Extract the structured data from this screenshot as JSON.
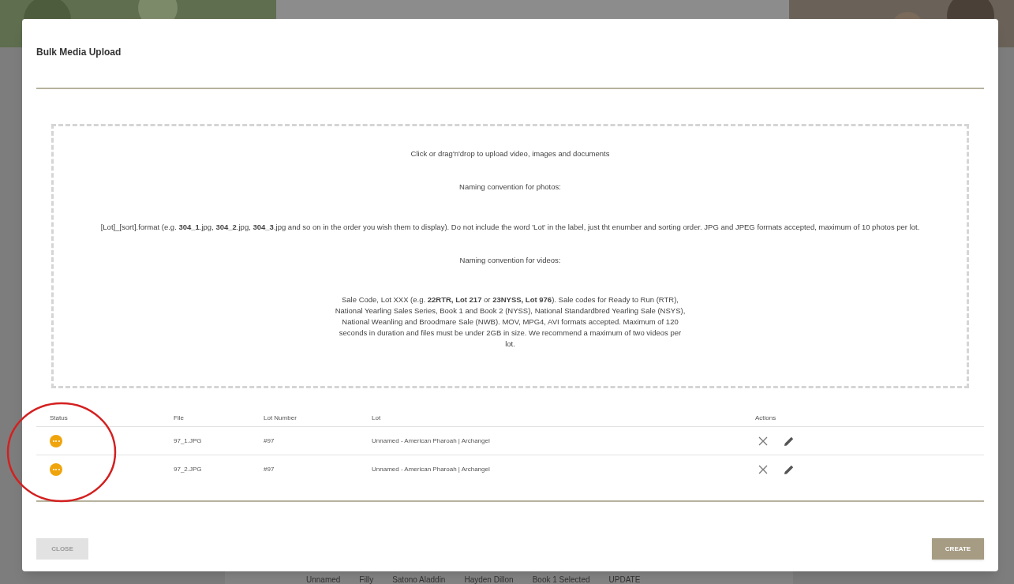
{
  "background": {
    "cells": [
      "Unnamed",
      "Filly",
      "Satono Aladdin",
      "Hayden Dillon",
      "Book 1 Selected",
      "UPDATE"
    ]
  },
  "dialog": {
    "title": "Bulk Media Upload",
    "dropzone": {
      "lines": [
        "Click or drag'n'drop to upload video, images and documents",
        "Naming convention for photos:",
        "[Lot]_[sort].format (e.g. **304_1**.jpg, **304_2**.jpg, **304_3**.jpg and so on in the order you wish them to display). Do not include the word 'Lot' in the label, just tht enumber and sorting order. JPG and JPEG formats accepted, maximum of 10 photos per lot.",
        "Naming convention for videos:",
        "Sale Code, Lot XXX (e.g. **22RTR, Lot 217** or **23NYSS, Lot 976**). Sale codes for Ready to Run (RTR), National Yearling Sales Series, Book 1 and Book 2 (NYSS), National Standardbred Yearling Sale (NSYS), National Weanling and Broodmare Sale (NWB). MOV, MPG4, AVI formats accepted. Maximum of 120 seconds in duration and files must be under 2GB in size. We recommend a maximum of two videos per lot."
      ]
    },
    "table": {
      "columns": [
        "Status",
        "File",
        "Lot Number",
        "Lot",
        "Actions"
      ],
      "rows": [
        {
          "color": "#f0a40c",
          "file": "97_1.JPG",
          "lot_number": "#97",
          "lot": "Unnamed - American Pharoah | Archangel"
        },
        {
          "color": "#f0a40c",
          "file": "97_2.JPG",
          "lot_number": "#97",
          "lot": "Unnamed - American Pharoah | Archangel"
        }
      ]
    },
    "buttons": [
      {
        "label": "CLOSE",
        "kind": "secondary"
      },
      {
        "label": "CREATE",
        "kind": "primary"
      }
    ]
  },
  "annotation": {
    "kind": "circle"
  }
}
